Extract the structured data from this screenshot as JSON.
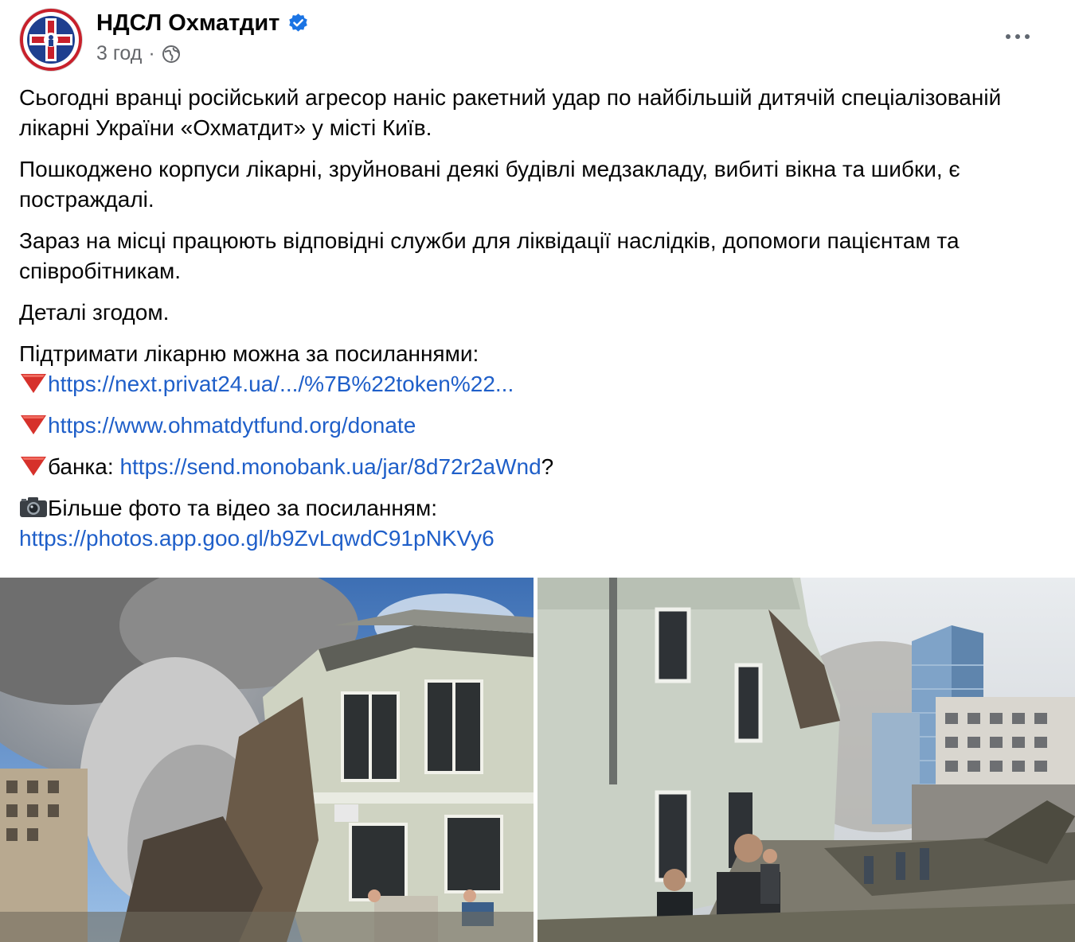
{
  "post": {
    "page_name": "НДСЛ Охматдит",
    "time": "3 год",
    "separator": "·",
    "paragraphs": [
      "Сьогодні вранці російський агресор наніс ракетний удар по найбільшій дитячій спеціалізованій лікарні України «Охматдит» у місті Київ.",
      "Пошкоджено корпуси лікарні, зруйновані деякі будівлі медзакладу, вибиті вікна та шибки, є постраждалі.",
      "Зараз на місці працюють відповідні служби для ліквідації наслідків, допомоги пацієнтам та співробітникам.",
      "Деталі згодом.",
      "Підтримати лікарню можна за посиланнями:"
    ],
    "links": {
      "privat": "https://next.privat24.ua/.../%7B%22token%22...",
      "fund": "https://www.ohmatdytfund.org/donate",
      "jar_label": "банка: ",
      "jar": "https://send.monobank.ua/jar/8d72r2aWnd",
      "jar_suffix": "?",
      "photos_label": "Більше фото та відео за посиланням:",
      "photos": "https://photos.app.goo.gl/b9ZvLqwdC91pNKVy6"
    },
    "icons": {
      "verified": "verified-badge-icon",
      "audience": "globe-icon",
      "bullet": "red-triangle-icon",
      "camera": "camera-icon",
      "more": "more-options-icon"
    },
    "colors": {
      "link": "#1f5fc9",
      "verified": "#1b74e4",
      "bullet": "#d6312b",
      "secondary_text": "#65676b"
    }
  }
}
